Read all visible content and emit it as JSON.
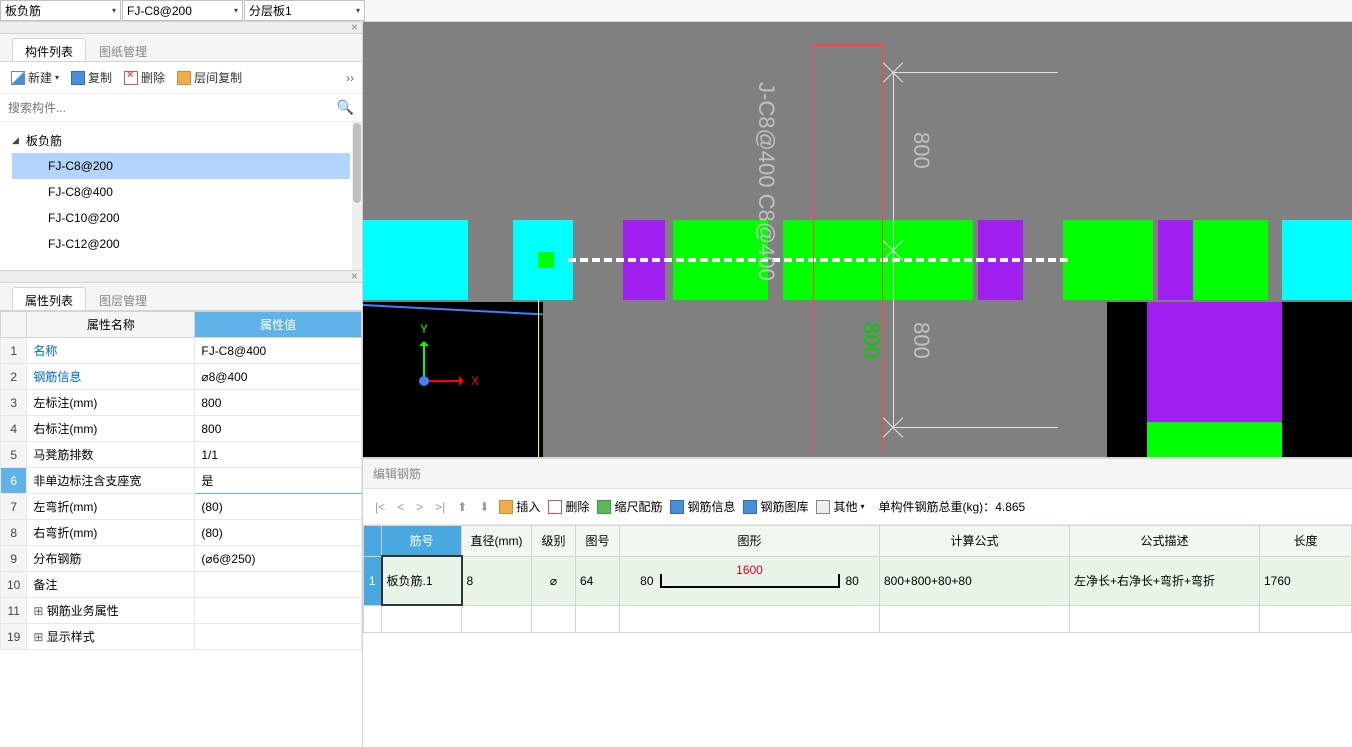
{
  "topDropdowns": {
    "d1": "板负筋",
    "d2": "FJ-C8@200",
    "d3": "分层板1"
  },
  "componentListPanel": {
    "tabs": {
      "t1": "构件列表",
      "t2": "图纸管理"
    },
    "toolbar": {
      "new": "新建",
      "copy": "复制",
      "delete": "删除",
      "floorCopy": "层间复制"
    },
    "searchPlaceholder": "搜索构件...",
    "treeTitle": "板负筋",
    "items": [
      "FJ-C8@200",
      "FJ-C8@400",
      "FJ-C10@200",
      "FJ-C12@200"
    ],
    "selectedIndex": 0
  },
  "propertyPanel": {
    "tabs": {
      "t1": "属性列表",
      "t2": "图层管理"
    },
    "headers": {
      "name": "属性名称",
      "value": "属性值"
    },
    "rows": [
      {
        "num": "1",
        "name": "名称",
        "value": "FJ-C8@400",
        "link": true
      },
      {
        "num": "2",
        "name": "钢筋信息",
        "value": "⌀8@400",
        "link": true
      },
      {
        "num": "3",
        "name": "左标注(mm)",
        "value": "800"
      },
      {
        "num": "4",
        "name": "右标注(mm)",
        "value": "800"
      },
      {
        "num": "5",
        "name": "马凳筋排数",
        "value": "1/1"
      },
      {
        "num": "6",
        "name": "非单边标注含支座宽",
        "value": "是",
        "selected": true
      },
      {
        "num": "7",
        "name": "左弯折(mm)",
        "value": "(80)"
      },
      {
        "num": "8",
        "name": "右弯折(mm)",
        "value": "(80)"
      },
      {
        "num": "9",
        "name": "分布钢筋",
        "value": "(⌀6@250)"
      },
      {
        "num": "10",
        "name": "备注",
        "value": ""
      },
      {
        "num": "11",
        "name": "钢筋业务属性",
        "value": "",
        "expandable": true
      },
      {
        "num": "19",
        "name": "显示样式",
        "value": "",
        "expandable": true
      }
    ]
  },
  "canvas": {
    "annotationMain": "J-C8@400  C8@400",
    "dim1": "800",
    "dim2": "800"
  },
  "bottomPanel": {
    "title": "编辑钢筋",
    "toolbar": {
      "insert": "插入",
      "delete": "删除",
      "scale": "缩尺配筋",
      "info": "钢筋信息",
      "lib": "钢筋图库",
      "other": "其他",
      "weightLabel": "单构件钢筋总重(kg)：",
      "weightValue": "4.865"
    },
    "headers": [
      "筋号",
      "直径(mm)",
      "级别",
      "图号",
      "图形",
      "计算公式",
      "公式描述",
      "长度"
    ],
    "row1": {
      "id": "板负筋.1",
      "dia": "8",
      "grade": "⌀",
      "shapeNo": "64",
      "shapeEnds": "80",
      "shapeMid": "1600",
      "formula": "800+800+80+80",
      "desc": "左净长+右净长+弯折+弯折",
      "len": "1760"
    }
  }
}
